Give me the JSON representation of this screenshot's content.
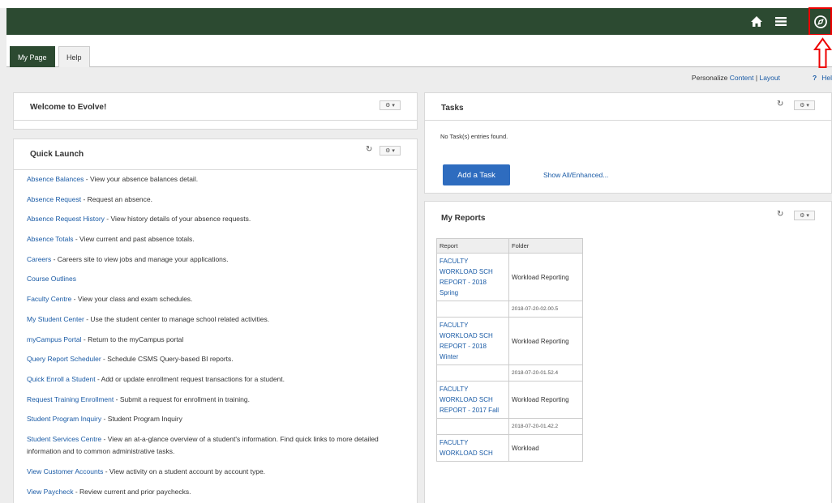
{
  "header": {
    "home_icon": "home-icon",
    "menu_icon": "menu-icon",
    "nav_icon": "navigator-icon"
  },
  "tabs": [
    {
      "label": "My Page",
      "active": true
    },
    {
      "label": "Help",
      "active": false
    }
  ],
  "personalize": {
    "prefix": "Personalize",
    "content_link": "Content",
    "separator": "|",
    "layout_link": "Layout",
    "help_q": "?",
    "help_label": "Hel"
  },
  "welcome": {
    "title": "Welcome to Evolve!"
  },
  "quick_launch": {
    "title": "Quick Launch",
    "items": [
      {
        "link": "Absence Balances",
        "desc": " - View your absence balances detail."
      },
      {
        "link": "Absence Request",
        "desc": " - Request an absence."
      },
      {
        "link": "Absence Request History",
        "desc": " - View history details of your absence requests."
      },
      {
        "link": "Absence Totals",
        "desc": " - View current and past absence totals."
      },
      {
        "link": "Careers",
        "desc": " - Careers site to view jobs and manage your applications."
      },
      {
        "link": "Course Outlines",
        "desc": ""
      },
      {
        "link": "Faculty Centre",
        "desc": " - View your class and exam schedules."
      },
      {
        "link": "My Student Center",
        "desc": " - Use the student center to manage school related activities."
      },
      {
        "link": "myCampus Portal",
        "desc": " - Return to the myCampus portal"
      },
      {
        "link": "Query Report Scheduler",
        "desc": " - Schedule CSMS Query-based BI reports."
      },
      {
        "link": "Quick Enroll a Student",
        "desc": " - Add or update enrollment request transactions for a student."
      },
      {
        "link": "Request Training Enrollment",
        "desc": " - Submit a request for enrollment in training."
      },
      {
        "link": "Student Program Inquiry",
        "desc": " - Student Program Inquiry"
      },
      {
        "link": "Student Services Centre",
        "desc": " - View an at-a-glance overview of a student's information. Find quick links to more detailed information and to common administrative tasks."
      },
      {
        "link": "View Customer Accounts",
        "desc": " - View activity on a student account by account type."
      },
      {
        "link": "View Paycheck",
        "desc": " - Review current and prior paychecks."
      }
    ]
  },
  "tasks": {
    "title": "Tasks",
    "empty_text": "No Task(s) entries found.",
    "add_button": "Add a Task",
    "show_all": "Show All/Enhanced..."
  },
  "reports": {
    "title": "My Reports",
    "columns": [
      "Report",
      "Folder"
    ],
    "rows": [
      {
        "name": "FACULTY WORKLOAD SCH REPORT - 2018 Spring",
        "folder": "Workload Reporting",
        "date": "2018-07-20-02.00.5"
      },
      {
        "name": "FACULTY WORKLOAD SCH REPORT - 2018 Winter",
        "folder": "Workload Reporting",
        "date": "2018-07-20-01.52.4"
      },
      {
        "name": "FACULTY WORKLOAD SCH REPORT - 2017 Fall",
        "folder": "Workload Reporting",
        "date": "2018-07-20-01.42.2"
      },
      {
        "name": "FACULTY WORKLOAD SCH",
        "folder": "Workload",
        "date": ""
      }
    ]
  },
  "colors": {
    "brand_green": "#2c4a31",
    "link_blue": "#1a5ba6",
    "button_blue": "#2e6cbf",
    "highlight_red": "#e00000"
  }
}
